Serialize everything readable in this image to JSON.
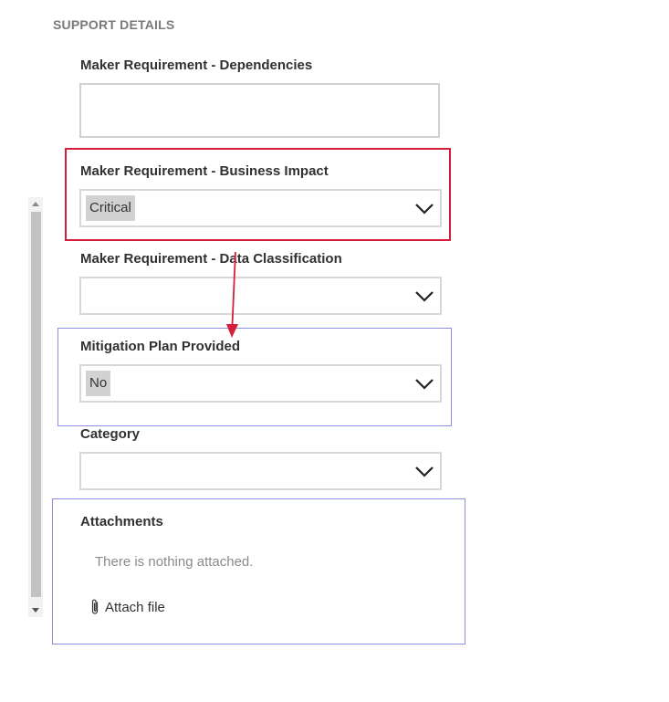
{
  "section": {
    "title": "SUPPORT DETAILS"
  },
  "fields": {
    "dependencies": {
      "label": "Maker Requirement - Dependencies",
      "value": ""
    },
    "business_impact": {
      "label": "Maker Requirement - Business Impact",
      "value": "Critical"
    },
    "data_classification": {
      "label": "Maker Requirement - Data Classification",
      "value": ""
    },
    "mitigation_plan": {
      "label": "Mitigation Plan Provided",
      "value": "No"
    },
    "category": {
      "label": "Category",
      "value": ""
    }
  },
  "attachments": {
    "label": "Attachments",
    "empty_text": "There is nothing attached.",
    "attach_label": "Attach file"
  },
  "colors": {
    "highlight_red": "#d51f3a",
    "highlight_blue": "#8e8ee0"
  },
  "icons": [
    "chevron-down-icon",
    "paperclip-icon",
    "arrow-down-icon"
  ]
}
